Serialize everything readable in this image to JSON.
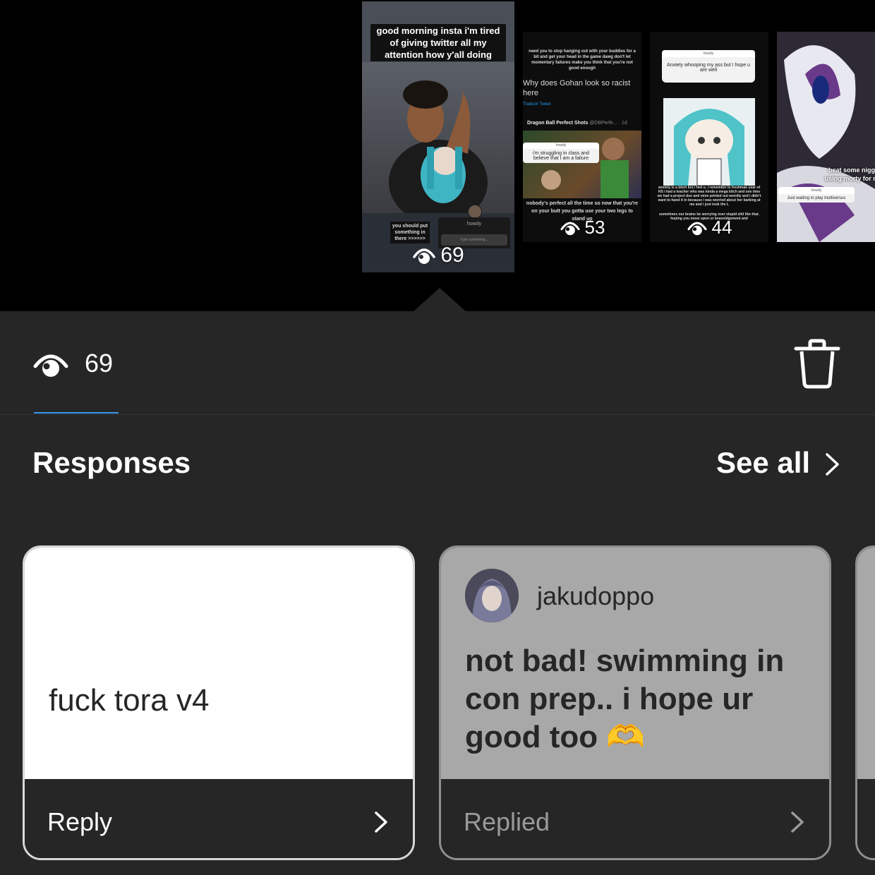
{
  "stories": {
    "active": {
      "caption": "good morning insta i'm tired of giving twitter all my attention how y'all doing",
      "sticker_text": "you should put something in there >>>>>>",
      "question_title": "howdy",
      "question_placeholder": "Type something...",
      "views": "69"
    },
    "second": {
      "top_text": "need you to stop hanging out with your buddies for a bit and get your head in the game dawg don't let momentary failures make you think that you're not good enough",
      "tweet_text": "Why does Gohan look so racist here",
      "translate": "Traducir Tweet",
      "account": "Dragon Ball Perfect Shots",
      "handle": "@DBPerfe... · 1d",
      "question_title": "howdy",
      "question_text": "i'm struggling in class and believe that I am a failure",
      "bottom_text": "nobody's perfect all the time so now that you're on your butt you gotta use your two legs to stand up",
      "views": "53"
    },
    "third": {
      "question_title": "howdy",
      "question_text": "Anxiety whooping my ass but I hope u are well",
      "body_text": "anxiety is a bitch bro i feel u. i remember in freshman year of HS i had a teacher who was kinda a mega bitch and one time we had a project due and mine printed out weirdly and i didn't want to hand it in because i was worried about her barking at me and i just took the L",
      "body_text_2": "sometimes our brains be worrying over stupid shit like that. hoping you move upon ur beavoidgement and",
      "views": "44"
    },
    "fourth": {
      "caption": "beat some nigg using morty for m",
      "question_title": "howdy",
      "question_text": "Just waiting to play multiversus"
    }
  },
  "stats": {
    "views": "69"
  },
  "responses": {
    "title": "Responses",
    "see_all": "See all",
    "cards": [
      {
        "message": "fuck tora v4",
        "action": "Reply"
      },
      {
        "username": "jakudoppo",
        "message": "not bad! swimming in con prep.. i hope ur good too 🫶",
        "action": "Replied"
      }
    ]
  }
}
